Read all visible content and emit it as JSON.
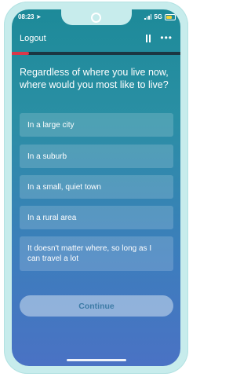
{
  "status_bar": {
    "time": "08:23",
    "network": "5G"
  },
  "header": {
    "logout_label": "Logout"
  },
  "progress": {
    "fraction": 0.1
  },
  "question": {
    "text": "Regardless of where you live now, where would you most like to live?"
  },
  "options": [
    {
      "label": "In a large city"
    },
    {
      "label": "In a suburb"
    },
    {
      "label": "In a small, quiet town"
    },
    {
      "label": "In a rural area"
    },
    {
      "label": "It doesn't matter where, so long as I can travel a lot"
    }
  ],
  "footer": {
    "continue_label": "Continue"
  },
  "colors": {
    "frame": "#c7ecec",
    "progress_fill": "#d8384a",
    "battery": "#f2d33a"
  }
}
